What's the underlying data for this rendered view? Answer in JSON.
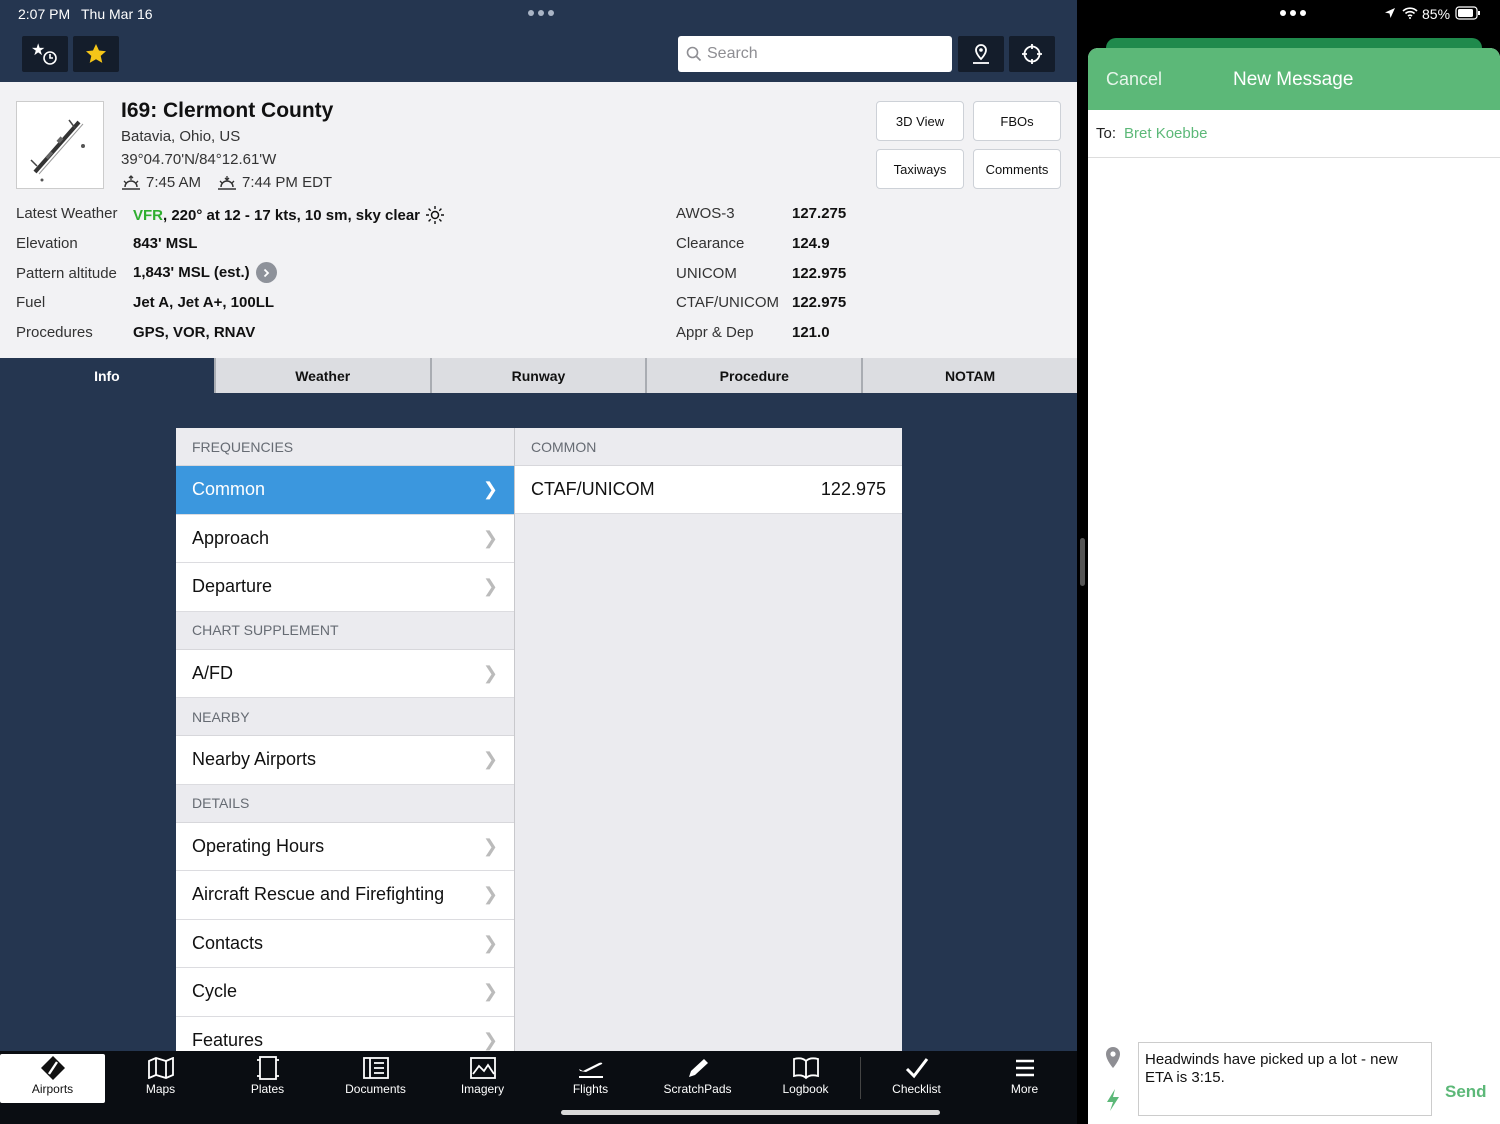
{
  "status": {
    "time": "2:07 PM",
    "date": "Thu Mar 16",
    "battery": "85%"
  },
  "search": {
    "placeholder": "Search"
  },
  "airport": {
    "title": "I69: Clermont County",
    "location": "Batavia, Ohio, US",
    "coordinates": "39°04.70'N/84°12.61'W",
    "sunrise": "7:45 AM",
    "sunset": "7:44 PM EDT"
  },
  "buttons": {
    "view3d": "3D View",
    "fbos": "FBOs",
    "taxiways": "Taxiways",
    "comments": "Comments"
  },
  "info": {
    "weather_label": "Latest Weather",
    "weather_flight_rules": "VFR",
    "weather_text": ", 220° at 12 - 17 kts, 10 sm, sky clear",
    "elevation_label": "Elevation",
    "elevation": "843' MSL",
    "pattern_label": "Pattern altitude",
    "pattern": "1,843' MSL (est.)",
    "fuel_label": "Fuel",
    "fuel": "Jet A, Jet A+, 100LL",
    "procedures_label": "Procedures",
    "procedures": "GPS, VOR, RNAV"
  },
  "freqs": [
    {
      "label": "AWOS-3",
      "value": "127.275"
    },
    {
      "label": "Clearance",
      "value": "124.9"
    },
    {
      "label": "UNICOM",
      "value": "122.975"
    },
    {
      "label": "CTAF/UNICOM",
      "value": "122.975"
    },
    {
      "label": "Appr & Dep",
      "value": "121.0"
    }
  ],
  "tabs": [
    "Info",
    "Weather",
    "Runway",
    "Procedure",
    "NOTAM"
  ],
  "list": {
    "frequencies_header": "FREQUENCIES",
    "common": "Common",
    "approach": "Approach",
    "departure": "Departure",
    "chart_supplement_header": "CHART SUPPLEMENT",
    "afd": "A/FD",
    "nearby_header": "NEARBY",
    "nearby_airports": "Nearby Airports",
    "details_header": "DETAILS",
    "operating_hours": "Operating Hours",
    "arff": "Aircraft Rescue and Firefighting",
    "contacts": "Contacts",
    "cycle": "Cycle",
    "features": "Features"
  },
  "detail": {
    "header": "COMMON",
    "row_label": "CTAF/UNICOM",
    "row_value": "122.975"
  },
  "tabbar": [
    "Airports",
    "Maps",
    "Plates",
    "Documents",
    "Imagery",
    "Flights",
    "ScratchPads",
    "Logbook",
    "Checklist",
    "More"
  ],
  "message": {
    "cancel": "Cancel",
    "title": "New Message",
    "to_label": "To:",
    "recipient": "Bret Koebbe",
    "body": "Headwinds have picked up a lot - new ETA is 3:15.",
    "send": "Send"
  },
  "colors": {
    "navy": "#253650",
    "selected_blue": "#3b97de",
    "vfr_green": "#2fae2f",
    "message_green": "#5cb878"
  }
}
